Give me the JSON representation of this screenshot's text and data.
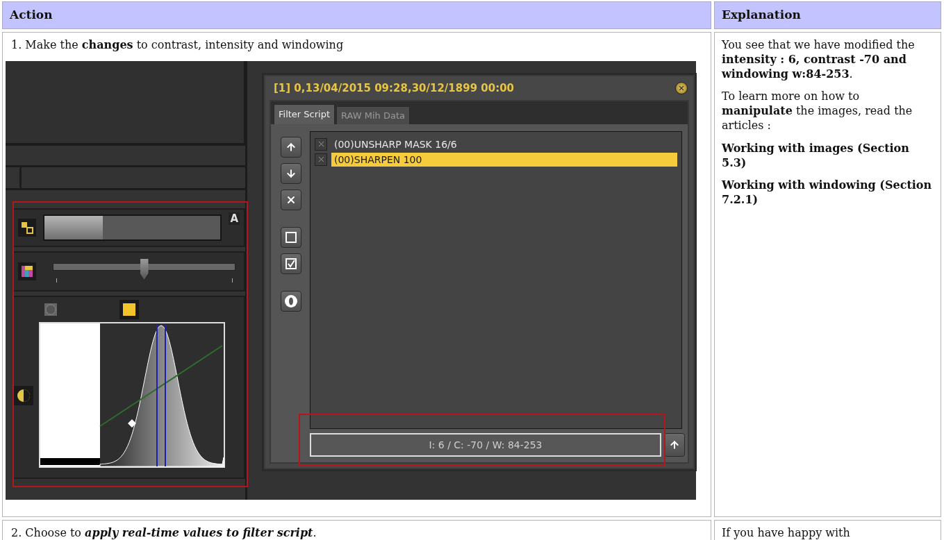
{
  "table": {
    "columns": [
      "Action",
      "Explanation"
    ],
    "rows": [
      {
        "action": "1. Make the **changes** to contrast, intensity and windowing",
        "italic_emphasis": false,
        "screenshot": {
          "left_panel": {
            "bar": {
              "level": 0.33,
              "label": "A"
            },
            "slider": {
              "level": 0.5
            }
          },
          "dialog": {
            "title": "[1] 0,13/04/2015 09:28,30/12/1899 00:00",
            "tabs": [
              {
                "label": "Filter Script",
                "selected": true
              },
              {
                "label": "RAW Mih Data",
                "selected": false
              }
            ],
            "filters": [
              {
                "label": "(00)UNSHARP MASK 16/6",
                "checked": true,
                "selected": false
              },
              {
                "label": "(00)SHARPEN 100",
                "checked": true,
                "selected": true
              }
            ],
            "values_field": {
              "value": "I: 6 / C: -70 / W: 84-253"
            }
          }
        },
        "explanation": [
          {
            "kind": "text",
            "text": "You see that we have modified the **intensity : 6, contrast -70 and windowing w:84-253**."
          },
          {
            "kind": "text",
            "text": "To learn more on how to **manipulate** the images, read the articles :"
          },
          {
            "kind": "heading",
            "text": "Working with images (Section 5.3)"
          },
          {
            "kind": "heading",
            "text": "Working with windowing (Section 7.2.1)"
          }
        ]
      },
      {
        "action": "2. Choose to **apply real-time values to filter script**.",
        "italic_emphasis": true,
        "explanation": [
          {
            "kind": "text",
            "text": "If you have happy with"
          }
        ]
      }
    ]
  }
}
